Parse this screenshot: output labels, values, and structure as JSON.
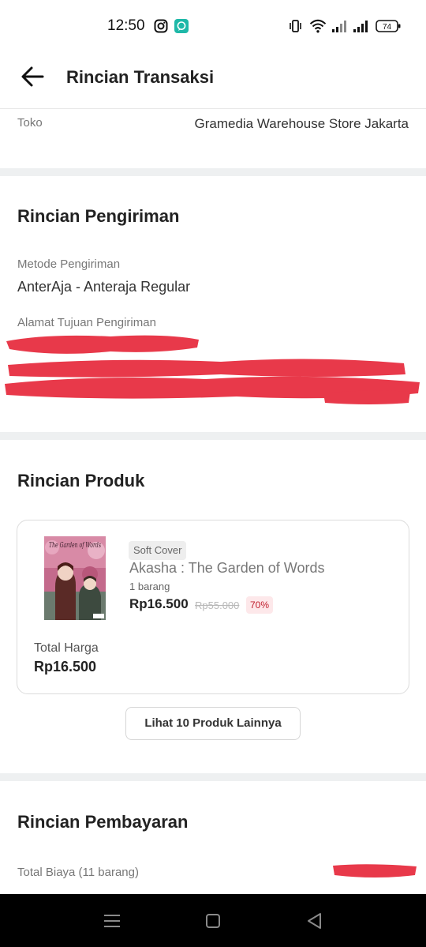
{
  "status_bar": {
    "time": "12:50",
    "battery": "74",
    "icons": [
      "instagram-icon",
      "chat-app-icon",
      "vibrate-icon",
      "wifi-icon",
      "signal-icon",
      "signal-icon",
      "battery-icon"
    ]
  },
  "header": {
    "title": "Rincian Transaksi",
    "back_icon": "arrow-left-icon"
  },
  "store": {
    "label": "Toko",
    "value": "Gramedia Warehouse Store Jakarta"
  },
  "shipping": {
    "title": "Rincian Pengiriman",
    "method_label": "Metode Pengiriman",
    "method_value": "AnterAja - Anteraja Regular",
    "address_label": "Alamat Tujuan Pengiriman"
  },
  "product": {
    "title": "Rincian Produk",
    "format_badge": "Soft Cover",
    "name": "Akasha : The Garden of Words",
    "quantity": "1 barang",
    "price": "Rp16.500",
    "original_price": "Rp55.000",
    "discount": "70%",
    "total_label": "Total Harga",
    "total_value": "Rp16.500",
    "cover_text": "The Garden of Words",
    "more_button": "Lihat 10 Produk Lainnya"
  },
  "payment": {
    "title": "Rincian Pembayaran",
    "total_label": "Total Biaya (11 barang)"
  },
  "colors": {
    "redaction": "#e8394a",
    "divider": "#eef0f1",
    "discount_text": "#c0202e",
    "discount_bg": "#fde8ea"
  },
  "nav_bar": {
    "icons": [
      "menu-icon",
      "home-square-icon",
      "back-triangle-icon"
    ]
  }
}
